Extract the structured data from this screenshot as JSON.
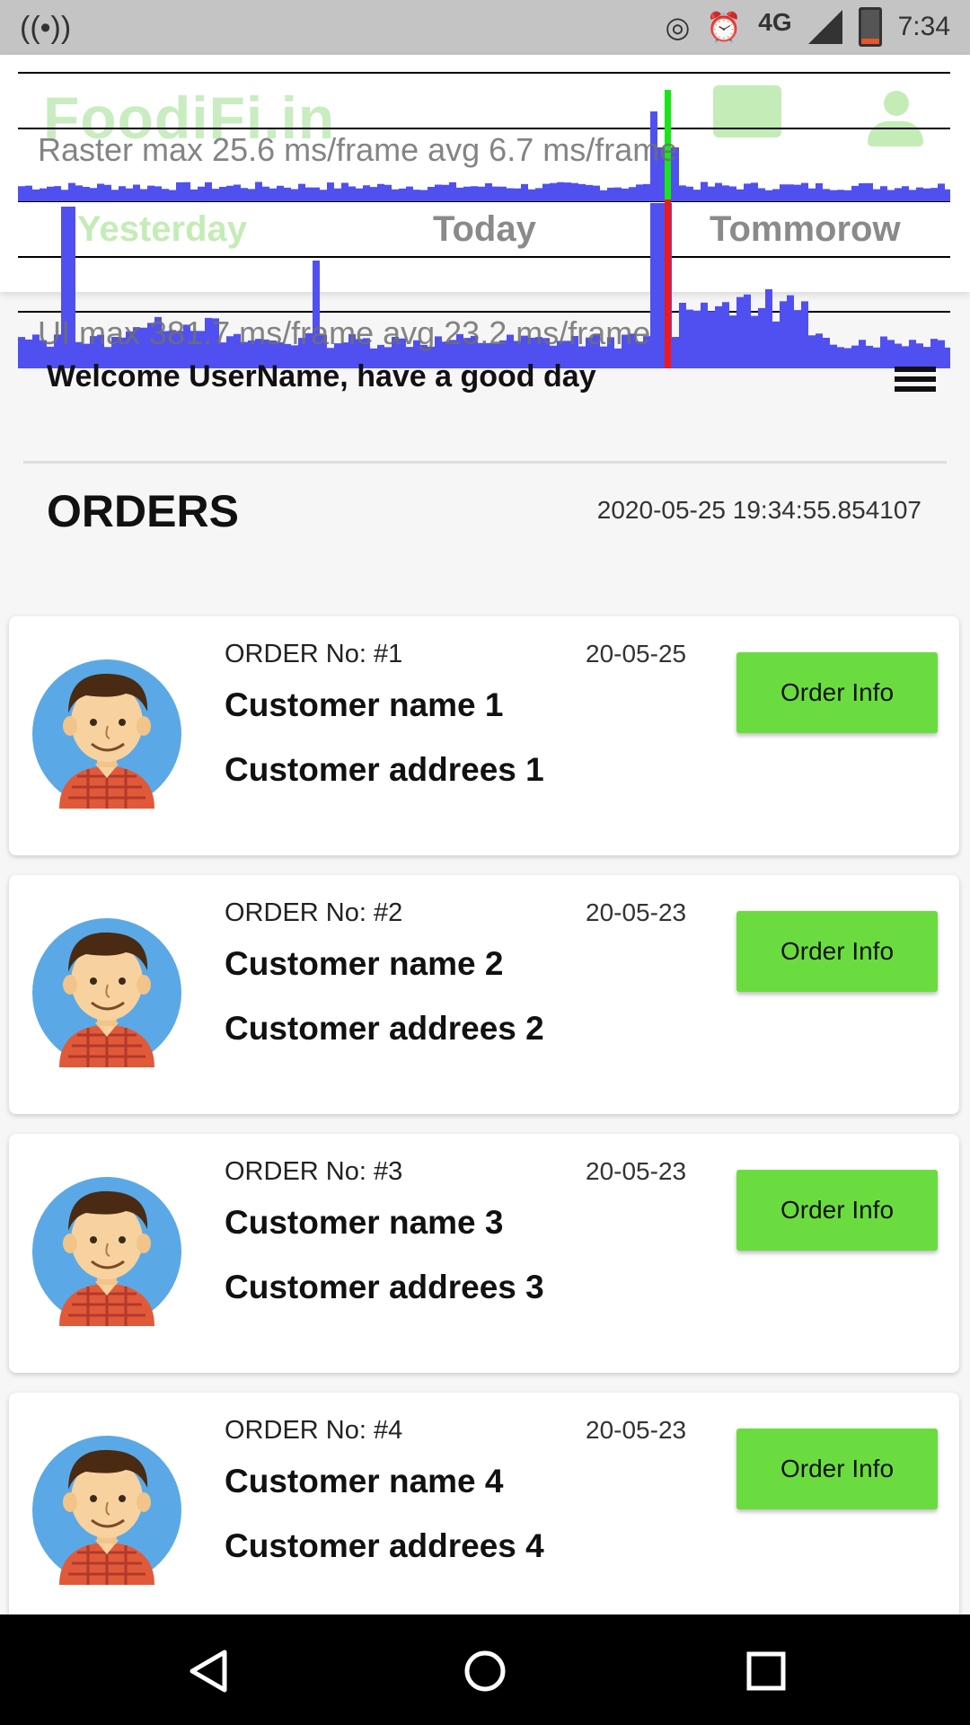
{
  "status_bar": {
    "time": "7:34",
    "network": "4G",
    "icons": [
      "hotspot-icon",
      "cast-icon",
      "alarm-icon",
      "signal-icon",
      "battery-icon"
    ]
  },
  "header": {
    "logo": "FoodiFi.in",
    "tabs": [
      {
        "label": "Yesterday",
        "active": true
      },
      {
        "label": "Today",
        "active": false
      },
      {
        "label": "Tommorow",
        "active": false
      }
    ],
    "icons": [
      "chat-icon",
      "profile-icon"
    ]
  },
  "perf_overlay": {
    "raster_label": "Raster  max 25.6 ms/frame  avg 6.7 ms/frame",
    "ui_label": "UI  max 381.7 ms/frame  avg 23.2 ms/frame"
  },
  "welcome": {
    "text": "Welcome UserName,  have a good day"
  },
  "orders": {
    "title": "ORDERS",
    "timestamp": "2020-05-25 19:34:55.854107",
    "button_label": "Order Info",
    "items": [
      {
        "order_no": "ORDER No: #1",
        "date": "20-05-25",
        "name": "Customer name 1",
        "address": "Customer addrees 1"
      },
      {
        "order_no": "ORDER No: #2",
        "date": "20-05-23",
        "name": "Customer name 2",
        "address": "Customer addrees 2"
      },
      {
        "order_no": "ORDER No: #3",
        "date": "20-05-23",
        "name": "Customer name 3",
        "address": "Customer addrees 3"
      },
      {
        "order_no": "ORDER No: #4",
        "date": "20-05-23",
        "name": "Customer name 4",
        "address": "Customer addrees 4"
      }
    ]
  },
  "colors": {
    "accent_green": "#6bdc3f",
    "logo_green": "#c9ecc0",
    "perf_bar": "#5050f0",
    "avatar_bg": "#5aa9e6"
  },
  "nav_bar": {
    "icons": [
      "back-icon",
      "home-icon",
      "recents-icon"
    ]
  }
}
